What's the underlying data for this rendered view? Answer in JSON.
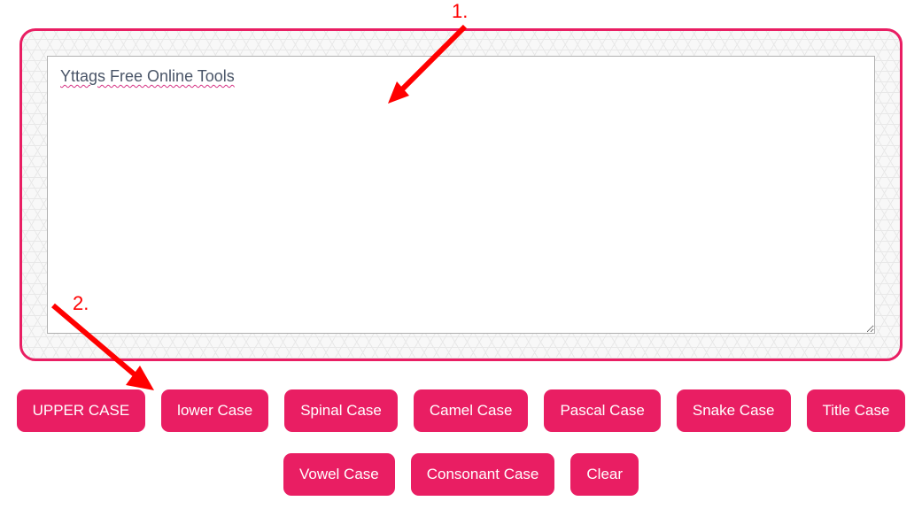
{
  "textarea": {
    "value": "Yttags Free Online Tools"
  },
  "buttons": {
    "upper": "UPPER CASE",
    "lower": "lower Case",
    "spinal": "Spinal Case",
    "camel": "Camel Case",
    "pascal": "Pascal Case",
    "snake": "Snake Case",
    "title": "Title Case",
    "vowel": "Vowel Case",
    "consonant": "Consonant Case",
    "clear": "Clear"
  },
  "annotations": {
    "label1": "1.",
    "label2": "2."
  },
  "colors": {
    "accent": "#e91e63",
    "annotation": "#ff0000"
  }
}
